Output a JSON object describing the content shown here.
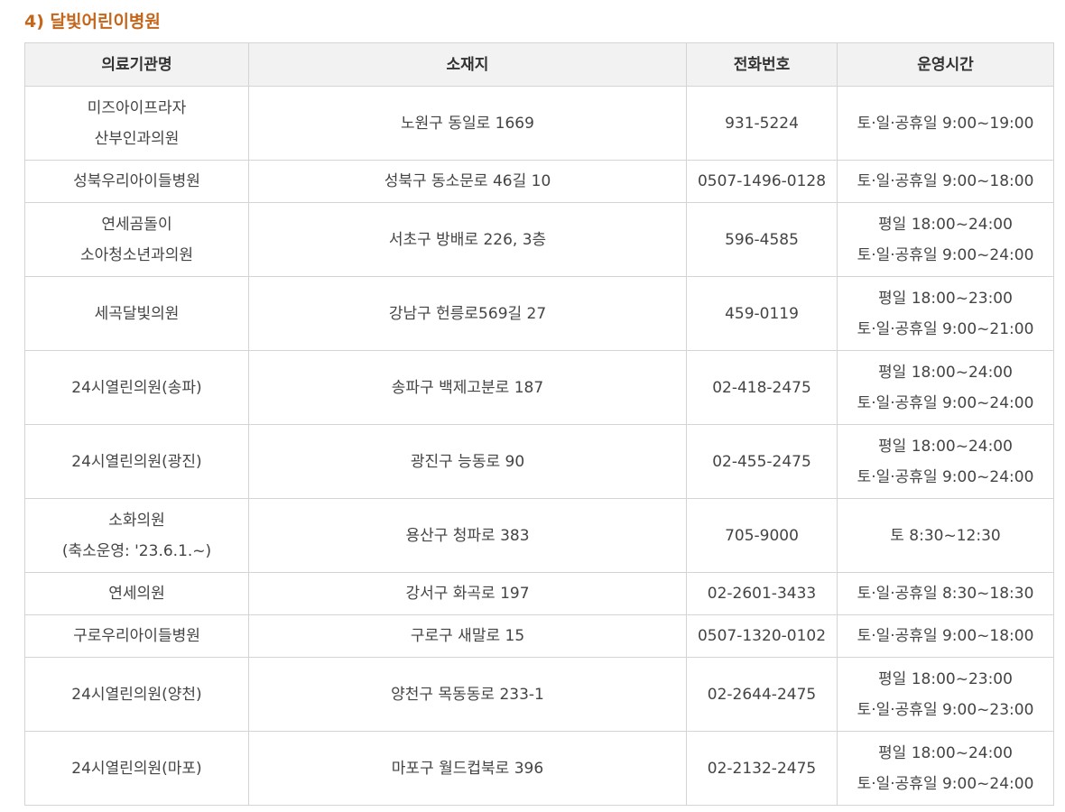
{
  "section": {
    "title": "4) 달빛어린이병원"
  },
  "table": {
    "headers": [
      "의료기관명",
      "소재지",
      "전화번호",
      "운영시간"
    ],
    "rows": [
      {
        "name": [
          "미즈아이프라자",
          "산부인과의원"
        ],
        "address": "노원구 동일로 1669",
        "phone": "931-5224",
        "hours": [
          "토·일·공휴일 9:00~19:00"
        ]
      },
      {
        "name": [
          "성북우리아이들병원"
        ],
        "address": "성북구 동소문로 46길 10",
        "phone": "0507-1496-0128",
        "hours": [
          "토·일·공휴일 9:00~18:00"
        ]
      },
      {
        "name": [
          "연세곰돌이",
          "소아청소년과의원"
        ],
        "address": "서초구 방배로 226, 3층",
        "phone": "596-4585",
        "hours": [
          "평일 18:00~24:00",
          "토·일·공휴일 9:00~24:00"
        ]
      },
      {
        "name": [
          "세곡달빛의원"
        ],
        "address": "강남구 헌릉로569길 27",
        "phone": "459-0119",
        "hours": [
          "평일 18:00~23:00",
          "토·일·공휴일 9:00~21:00"
        ]
      },
      {
        "name": [
          "24시열린의원(송파)"
        ],
        "address": "송파구 백제고분로 187",
        "phone": "02-418-2475",
        "hours": [
          "평일 18:00~24:00",
          "토·일·공휴일 9:00~24:00"
        ]
      },
      {
        "name": [
          "24시열린의원(광진)"
        ],
        "address": "광진구 능동로 90",
        "phone": "02-455-2475",
        "hours": [
          "평일 18:00~24:00",
          "토·일·공휴일 9:00~24:00"
        ]
      },
      {
        "name": [
          "소화의원",
          "(축소운영: '23.6.1.~)"
        ],
        "address": "용산구 청파로 383",
        "phone": "705-9000",
        "hours": [
          "토 8:30~12:30"
        ]
      },
      {
        "name": [
          "연세의원"
        ],
        "address": "강서구 화곡로 197",
        "phone": "02-2601-3433",
        "hours": [
          "토·일·공휴일 8:30~18:30"
        ]
      },
      {
        "name": [
          "구로우리아이들병원"
        ],
        "address": "구로구 새말로 15",
        "phone": "0507-1320-0102",
        "hours": [
          "토·일·공휴일 9:00~18:00"
        ]
      },
      {
        "name": [
          "24시열린의원(양천)"
        ],
        "address": "양천구 목동동로 233-1",
        "phone": "02-2644-2475",
        "hours": [
          "평일 18:00~23:00",
          "토·일·공휴일 9:00~23:00"
        ]
      },
      {
        "name": [
          "24시열린의원(마포)"
        ],
        "address": "마포구 월드컵북로 396",
        "phone": "02-2132-2475",
        "hours": [
          "평일 18:00~24:00",
          "토·일·공휴일 9:00~24:00"
        ]
      }
    ]
  },
  "colors": {
    "title": "#c4661b",
    "header_bg": "#f2f2f2",
    "border": "#d4d4d4",
    "text": "#444444"
  }
}
